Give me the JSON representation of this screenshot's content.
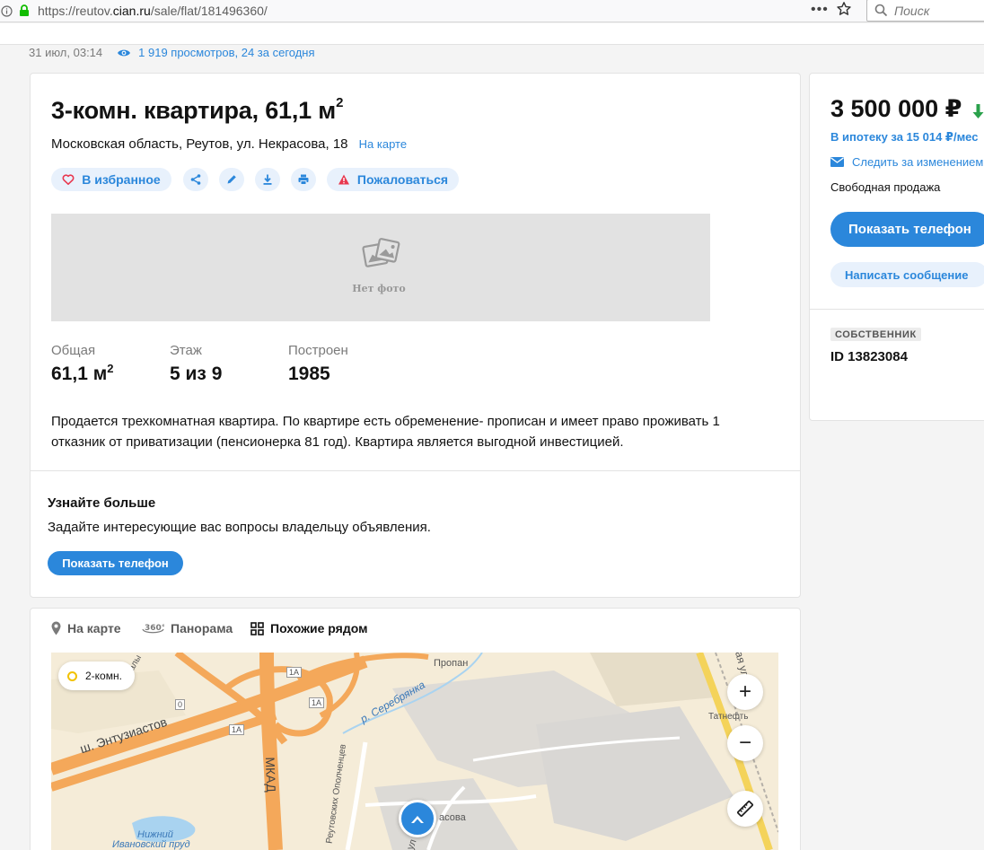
{
  "browser": {
    "url_prefix": "https://reutov.",
    "url_domain": "cian.ru",
    "url_path": "/sale/flat/181496360/",
    "menu": "•••",
    "search_placeholder": "Поиск"
  },
  "meta": {
    "date": "31 июл, 03:14",
    "views": "1 919 просмотров, 24 за сегодня"
  },
  "listing": {
    "title": "3-комн. квартира, 61,1 м",
    "title_sup": "2",
    "address": "Московская область, Реутов, ул. Некрасова, 18",
    "map_link": "На карте",
    "actions": {
      "favorite": "В избранное",
      "complain": "Пожаловаться"
    },
    "no_photo": "Нет фото",
    "specs": [
      {
        "label": "Общая",
        "value": "61,1 м",
        "sup": "2"
      },
      {
        "label": "Этаж",
        "value": "5 из 9"
      },
      {
        "label": "Построен",
        "value": "1985"
      }
    ],
    "description": "Продается трехкомнатная квартира. По квартире есть обременение- прописан и имеет право проживать 1 отказник от приватизации (пенсионерка 81 год). Квартира является выгодной инвестицией."
  },
  "contact_section": {
    "title": "Узнайте больше",
    "text": "Задайте интересующие вас вопросы владельцу объявления.",
    "phone_button": "Показать телефон"
  },
  "map_section": {
    "tabs": [
      {
        "label": "На карте"
      },
      {
        "label": "Панорама"
      },
      {
        "label": "Похожие рядом"
      }
    ],
    "chip": "2-комн.",
    "zoom_in": "+",
    "zoom_out": "−",
    "labels": {
      "street1": "ш. Энтузиастов",
      "mkad": "МКАД",
      "river": "р. Серебрянка",
      "propan": "Пропан",
      "tatneft": "Татнефть",
      "pond": "Нижний",
      "pond2": "Ивановский пруд",
      "opolch": "Реутовских Ополченцев",
      "nekrasova": "асова",
      "ul": "ул",
      "mal": "Малы",
      "ya_ul": "ая ул",
      "road_1a_1": "1А",
      "road_1a_2": "1А",
      "road_1a_3": "1А",
      "road_0": "0"
    }
  },
  "sidebar": {
    "price": "3 500 000 ₽",
    "mortgage": "В ипотеку за 15 014 ₽/мес",
    "follow": "Следить за изменением",
    "sale_type": "Свободная продажа",
    "phone_button": "Показать телефон",
    "message_button": "Написать сообщение",
    "owner_badge": "СОБСТВЕННИК",
    "listing_id": "ID 13823084"
  },
  "colors": {
    "accent": "#2b87db",
    "accent_light": "#e8f1fc",
    "price_down": "#2aa14b",
    "warning": "#e8384f"
  }
}
